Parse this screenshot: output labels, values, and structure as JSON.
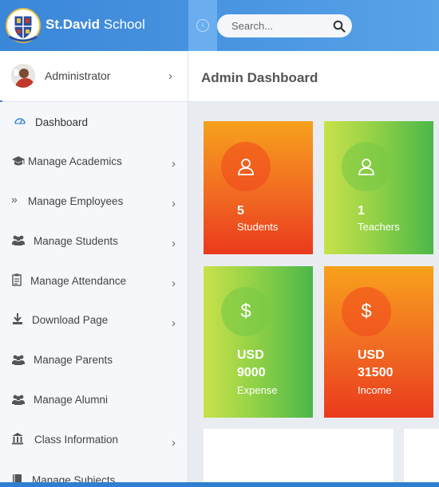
{
  "brand": {
    "bold": "St.David",
    "normal": "School"
  },
  "search": {
    "placeholder": "Search..."
  },
  "admin": {
    "label": "Administrator"
  },
  "nav": [
    {
      "label": "Dashboard",
      "icon": "dashboard-icon",
      "has_chevron": false
    },
    {
      "label": "Manage Academics",
      "icon": "graduation-cap-icon",
      "has_chevron": true
    },
    {
      "label": "Manage Employees",
      "icon": "double-chevron-icon",
      "has_chevron": true
    },
    {
      "label": "Manage Students",
      "icon": "users-icon",
      "has_chevron": true
    },
    {
      "label": "Manage Attendance",
      "icon": "clipboard-icon",
      "has_chevron": true
    },
    {
      "label": "Download Page",
      "icon": "download-icon",
      "has_chevron": true
    },
    {
      "label": "Manage Parents",
      "icon": "users-icon",
      "has_chevron": false
    },
    {
      "label": "Manage Alumni",
      "icon": "users-icon",
      "has_chevron": false
    },
    {
      "label": "Class Information",
      "icon": "building-icon",
      "has_chevron": true
    },
    {
      "label": "Manage Subjects",
      "icon": "book-icon",
      "has_chevron": false
    }
  ],
  "page": {
    "title": "Admin Dashboard"
  },
  "cards": [
    {
      "value": "5",
      "label": "Students",
      "style": "orange",
      "icon": "user-icon"
    },
    {
      "value": "1",
      "label": "Teachers",
      "style": "green",
      "icon": "user-icon"
    },
    {
      "currency": "USD",
      "value": "9000",
      "label": "Expense",
      "style": "green",
      "icon": "dollar-icon"
    },
    {
      "currency": "USD",
      "value": "31500",
      "label": "Income",
      "style": "orange",
      "icon": "dollar-icon"
    }
  ],
  "colors": {
    "header": "#3a86d8",
    "orange": "#f16a22",
    "green": "#4bb748",
    "accent": "#3a86d8"
  }
}
